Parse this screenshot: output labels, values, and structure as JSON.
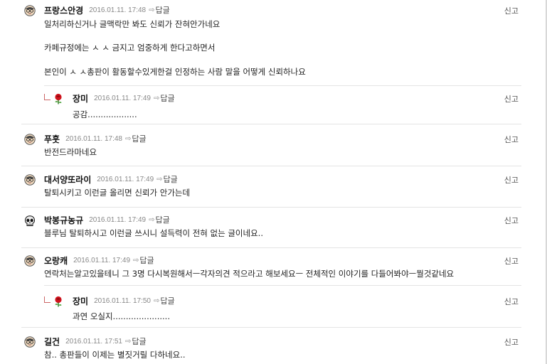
{
  "comments": [
    {
      "name": "프랑스안경",
      "date": "2016.01.11. 17:48",
      "reply": "답글",
      "report": "신고",
      "lines": [
        "일처리하신거나 글맥락만 봐도 신뢰가 잔혀안가네요",
        "카페규정에는 ㅅ ㅅ 금지고 엄중하게 한다고하면서",
        "본인이 ㅅ ㅅ총판이 활동할수있게한걸 인정하는 사람 말을 어떻게 신뢰하나요"
      ]
    },
    {
      "name": "장미",
      "date": "2016.01.11. 17:49",
      "reply": "답글",
      "report": "신고",
      "lines": [
        "공감..................."
      ]
    },
    {
      "name": "푸훗",
      "date": "2016.01.11. 17:48",
      "reply": "답글",
      "report": "신고",
      "lines": [
        "반전드라마네요"
      ]
    },
    {
      "name": "대서양또라이",
      "date": "2016.01.11. 17:49",
      "reply": "답글",
      "report": "신고",
      "lines": [
        "탈퇴시키고 이런글 올리면 신뢰가 안가는데"
      ]
    },
    {
      "name": "박봉규농규",
      "date": "2016.01.11. 17:49",
      "reply": "답글",
      "report": "신고",
      "lines": [
        "블루님 탈퇴하시고 이런글 쓰시니 설득력이 전혀 없는 글이네요.."
      ]
    },
    {
      "name": "오랑캐",
      "date": "2016.01.11. 17:49",
      "reply": "답글",
      "report": "신고",
      "lines": [
        "연락처는알고있을테니 그 3명 다시복원해서ㅡ각자의견 적으라고 해보세요ㅡ 전체적인 이야기를 다들어봐야ㅡ뭘것같네요"
      ]
    },
    {
      "name": "장미",
      "date": "2016.01.11. 17:50",
      "reply": "답글",
      "report": "신고",
      "lines": [
        "과연 오실지......................"
      ]
    },
    {
      "name": "길건",
      "date": "2016.01.11. 17:51",
      "reply": "답글",
      "report": "신고",
      "lines": [
        "참.. 총판들이 이제는 별짓거릴 다하네요.."
      ]
    }
  ],
  "icons": {
    "default_avatar": "face-glasses-icon",
    "rose_avatar": "rose-icon",
    "skull_avatar": "skull-icon",
    "reply_arrow": "reply-arrow-icon"
  }
}
